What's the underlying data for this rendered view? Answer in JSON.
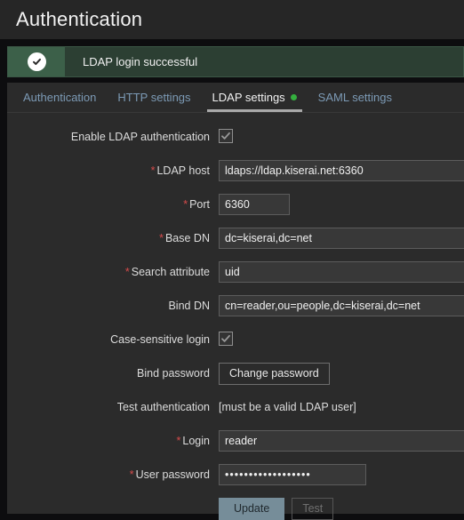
{
  "header": {
    "title": "Authentication"
  },
  "banner": {
    "icon": "success-check-icon",
    "message": "LDAP login successful",
    "color": "#3c6049"
  },
  "tabs": [
    {
      "label": "Authentication",
      "active": false,
      "dot": false
    },
    {
      "label": "HTTP settings",
      "active": false,
      "dot": false
    },
    {
      "label": "LDAP settings",
      "active": true,
      "dot": true
    },
    {
      "label": "SAML settings",
      "active": false,
      "dot": false
    }
  ],
  "form": {
    "enable_ldap": {
      "label": "Enable LDAP authentication",
      "checked": true
    },
    "ldap_host": {
      "label": "LDAP host",
      "required": true,
      "value": "ldaps://ldap.kiserai.net:6360",
      "placeholder": ""
    },
    "port": {
      "label": "Port",
      "required": true,
      "value": "6360",
      "placeholder": ""
    },
    "base_dn": {
      "label": "Base DN",
      "required": true,
      "value": "dc=kiserai,dc=net",
      "placeholder": ""
    },
    "search_attribute": {
      "label": "Search attribute",
      "required": true,
      "value": "uid",
      "placeholder": ""
    },
    "bind_dn": {
      "label": "Bind DN",
      "required": false,
      "value": "cn=reader,ou=people,dc=kiserai,dc=net",
      "placeholder": ""
    },
    "case_sensitive_login": {
      "label": "Case-sensitive login",
      "checked": true
    },
    "bind_password": {
      "label": "Bind password",
      "button_label": "Change password"
    },
    "test_authentication": {
      "label": "Test authentication",
      "hint": "[must be a valid LDAP user]"
    },
    "login": {
      "label": "Login",
      "required": true,
      "value": "reader",
      "placeholder": ""
    },
    "user_password": {
      "label": "User password",
      "required": true,
      "value": "••••••••••••••••••",
      "placeholder": ""
    }
  },
  "actions": {
    "update_label": "Update",
    "test_label": "Test"
  },
  "colors": {
    "accent_green": "#34af3e",
    "required_red": "#d64b4b",
    "primary_button": "#768d99"
  }
}
